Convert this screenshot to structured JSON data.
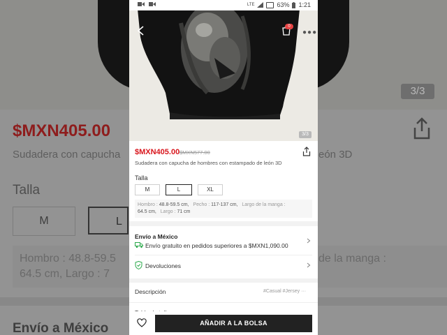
{
  "status_bar": {
    "network": "LTE",
    "battery": "63%",
    "time": "1:21"
  },
  "gallery": {
    "counter": "3/3",
    "cart_badge": "0"
  },
  "product": {
    "price": "$MXN405.00",
    "original_price": "$MXN577.00",
    "title": "Sudadera con capucha de hombres con estampado de león 3D",
    "size_label": "Talla",
    "sizes": [
      "M",
      "L",
      "XL"
    ],
    "selected_size": "L",
    "measurements": {
      "shoulder_label": "Hombro :",
      "shoulder_value": "48.8-59.5 cm,",
      "chest_label": "Pecho :",
      "chest_value": "117-137 cm,",
      "sleeve_label": "Largo de la manga :",
      "sleeve_value": "64.5 cm,",
      "length_label": "Largo :",
      "length_value": "71 cm"
    }
  },
  "shipping": {
    "title": "Envío a México",
    "free_text": "Envío gratuito en pedidos superiores a $MXN1,090.00",
    "returns": "Devoluciones"
  },
  "description": {
    "label": "Descripción",
    "tags": "#Casual  #Jersey"
  },
  "size_chart": {
    "label": "Tabla de tallas"
  },
  "bottom_bar": {
    "add_to_bag": "AÑADIR A LA BOLSA"
  },
  "background_echo": {
    "price": "$MXN405.00",
    "title_left": "Sudadera con capucha",
    "title_right": "eón 3D",
    "size_label": "Talla",
    "size_m": "M",
    "size_l": "L",
    "meas_line1": "Hombro :   48.8-59.5",
    "meas_line2": "64.5 cm,    Largo :  7",
    "meas_right": "de la manga :",
    "envio": "Envío a México",
    "counter": "3/3"
  },
  "colors": {
    "price_red": "#d9161d",
    "button_dark": "#222222"
  }
}
